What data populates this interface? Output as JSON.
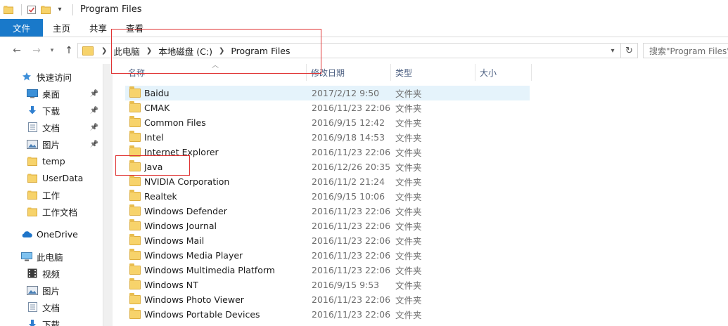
{
  "window": {
    "title": "Program Files"
  },
  "ribbon": {
    "tabs": [
      "文件",
      "主页",
      "共享",
      "查看"
    ]
  },
  "address": {
    "crumbs": [
      "此电脑",
      "本地磁盘 (C:)",
      "Program Files"
    ],
    "search_placeholder": "搜索\"Program Files\""
  },
  "columns": {
    "name": "名称",
    "date": "修改日期",
    "type": "类型",
    "size": "大小"
  },
  "nav": [
    {
      "label": "快速访问",
      "icon": "star-icon",
      "pinned": false
    },
    {
      "label": "桌面",
      "icon": "desktop-icon",
      "pinned": true
    },
    {
      "label": "下载",
      "icon": "download-icon",
      "pinned": true
    },
    {
      "label": "文档",
      "icon": "document-icon",
      "pinned": true
    },
    {
      "label": "图片",
      "icon": "picture-icon",
      "pinned": true
    },
    {
      "label": "temp",
      "icon": "folder-icon",
      "pinned": false
    },
    {
      "label": "UserData",
      "icon": "folder-icon",
      "pinned": false
    },
    {
      "label": "工作",
      "icon": "folder-icon",
      "pinned": false
    },
    {
      "label": "工作文档",
      "icon": "folder-icon",
      "pinned": false
    },
    {
      "label": "OneDrive",
      "icon": "cloud-icon",
      "pinned": false
    },
    {
      "label": "此电脑",
      "icon": "computer-icon",
      "pinned": false
    },
    {
      "label": "视频",
      "icon": "video-icon",
      "pinned": false
    },
    {
      "label": "图片",
      "icon": "picture-icon",
      "pinned": false
    },
    {
      "label": "文档",
      "icon": "document-icon",
      "pinned": false
    },
    {
      "label": "下载",
      "icon": "download-icon",
      "pinned": false
    }
  ],
  "files": [
    {
      "name": "Baidu",
      "date": "2017/2/12 9:50",
      "type": "文件夹"
    },
    {
      "name": "CMAK",
      "date": "2016/11/23 22:06",
      "type": "文件夹"
    },
    {
      "name": "Common Files",
      "date": "2016/9/15 12:42",
      "type": "文件夹"
    },
    {
      "name": "Intel",
      "date": "2016/9/18 14:53",
      "type": "文件夹"
    },
    {
      "name": "Internet Explorer",
      "date": "2016/11/23 22:06",
      "type": "文件夹"
    },
    {
      "name": "Java",
      "date": "2016/12/26 20:35",
      "type": "文件夹"
    },
    {
      "name": "NVIDIA Corporation",
      "date": "2016/11/2 21:24",
      "type": "文件夹"
    },
    {
      "name": "Realtek",
      "date": "2016/9/15 10:06",
      "type": "文件夹"
    },
    {
      "name": "Windows Defender",
      "date": "2016/11/23 22:06",
      "type": "文件夹"
    },
    {
      "name": "Windows Journal",
      "date": "2016/11/23 22:06",
      "type": "文件夹"
    },
    {
      "name": "Windows Mail",
      "date": "2016/11/23 22:06",
      "type": "文件夹"
    },
    {
      "name": "Windows Media Player",
      "date": "2016/11/23 22:06",
      "type": "文件夹"
    },
    {
      "name": "Windows Multimedia Platform",
      "date": "2016/11/23 22:06",
      "type": "文件夹"
    },
    {
      "name": "Windows NT",
      "date": "2016/9/15 9:53",
      "type": "文件夹"
    },
    {
      "name": "Windows Photo Viewer",
      "date": "2016/11/23 22:06",
      "type": "文件夹"
    },
    {
      "name": "Windows Portable Devices",
      "date": "2016/11/23 22:06",
      "type": "文件夹"
    }
  ],
  "colors": {
    "accent": "#1979ca",
    "folder": "#f7d36b",
    "selection": "#e5f3fb",
    "annotation": "#e03434"
  }
}
